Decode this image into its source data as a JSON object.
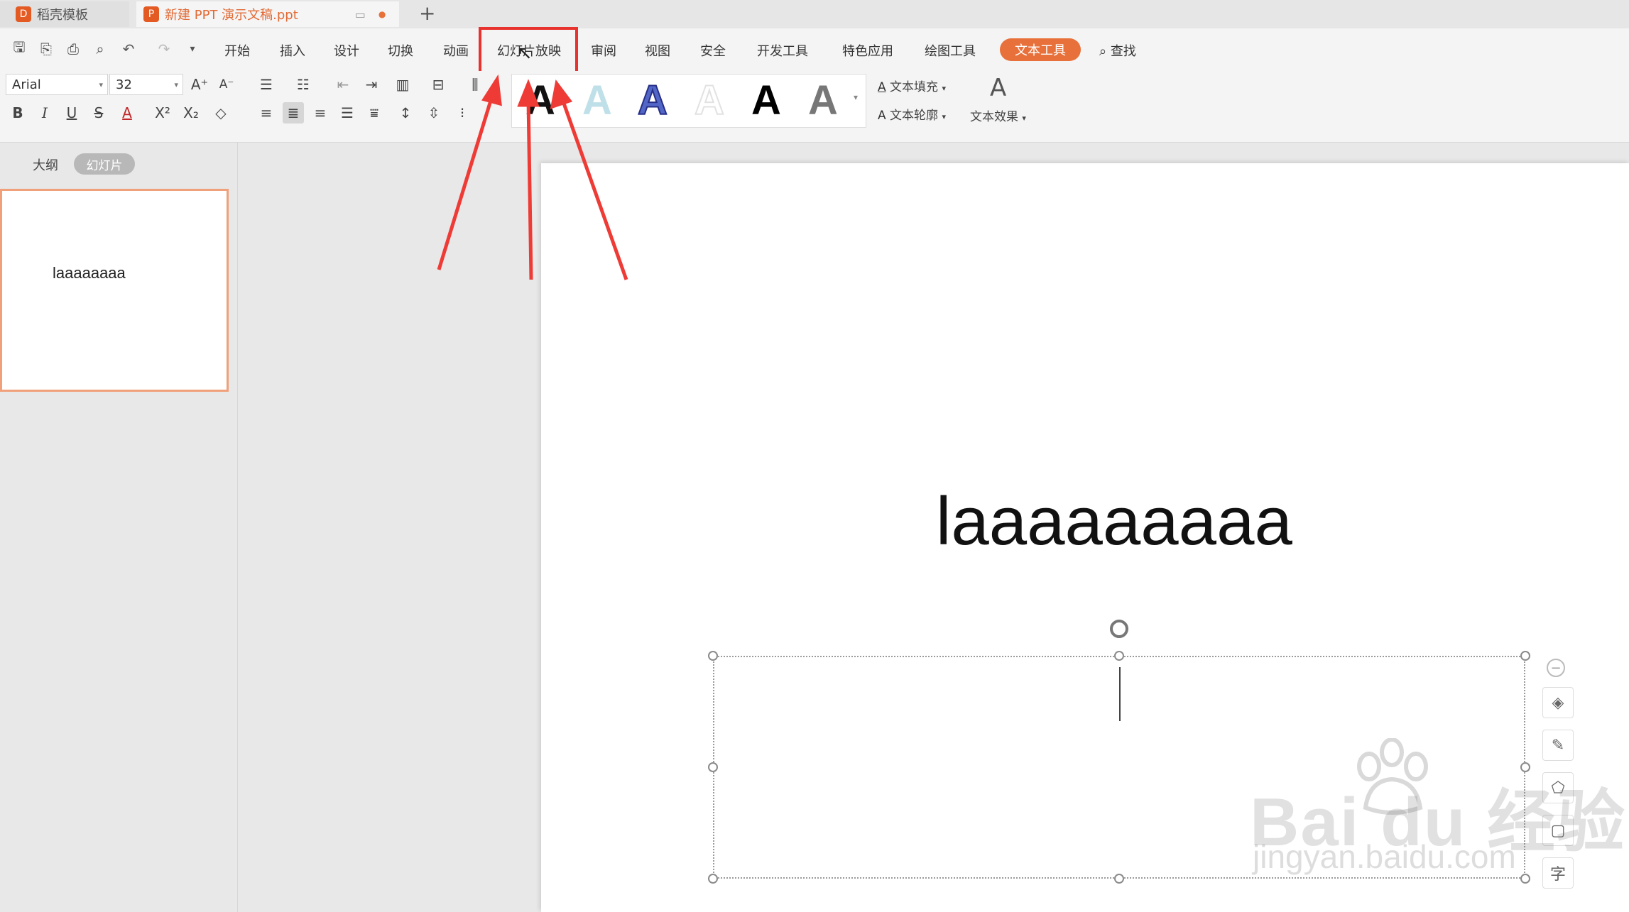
{
  "tabs": [
    {
      "label": "稻壳模板"
    },
    {
      "label": "新建 PPT 演示文稿.ppt"
    }
  ],
  "new_tab_label": "+",
  "menu": {
    "items": [
      "开始",
      "插入",
      "设计",
      "切换",
      "动画",
      "幻灯片放映",
      "审阅",
      "视图",
      "安全",
      "开发工具",
      "特色应用",
      "绘图工具",
      "文本工具"
    ],
    "active": "文本工具",
    "search_label": "查找"
  },
  "ribbon": {
    "font_name": "Arial",
    "font_size": "32",
    "text_fill_label": "文本填充",
    "text_outline_label": "文本轮廓",
    "text_effect_label": "文本效果",
    "gallery_glyph": "A"
  },
  "panel": {
    "outline_tab": "大纲",
    "slides_tab": "幻灯片",
    "thumb_text": "laaaaaaaa"
  },
  "slide": {
    "title_text": "laaaaaaaaa"
  },
  "watermark": {
    "line1": "Bai du 经验",
    "line2": "jingyan.baidu.com"
  },
  "colors": {
    "accent": "#e8703a",
    "highlight_box": "#e8322e",
    "arrow": "#ee3b36"
  }
}
